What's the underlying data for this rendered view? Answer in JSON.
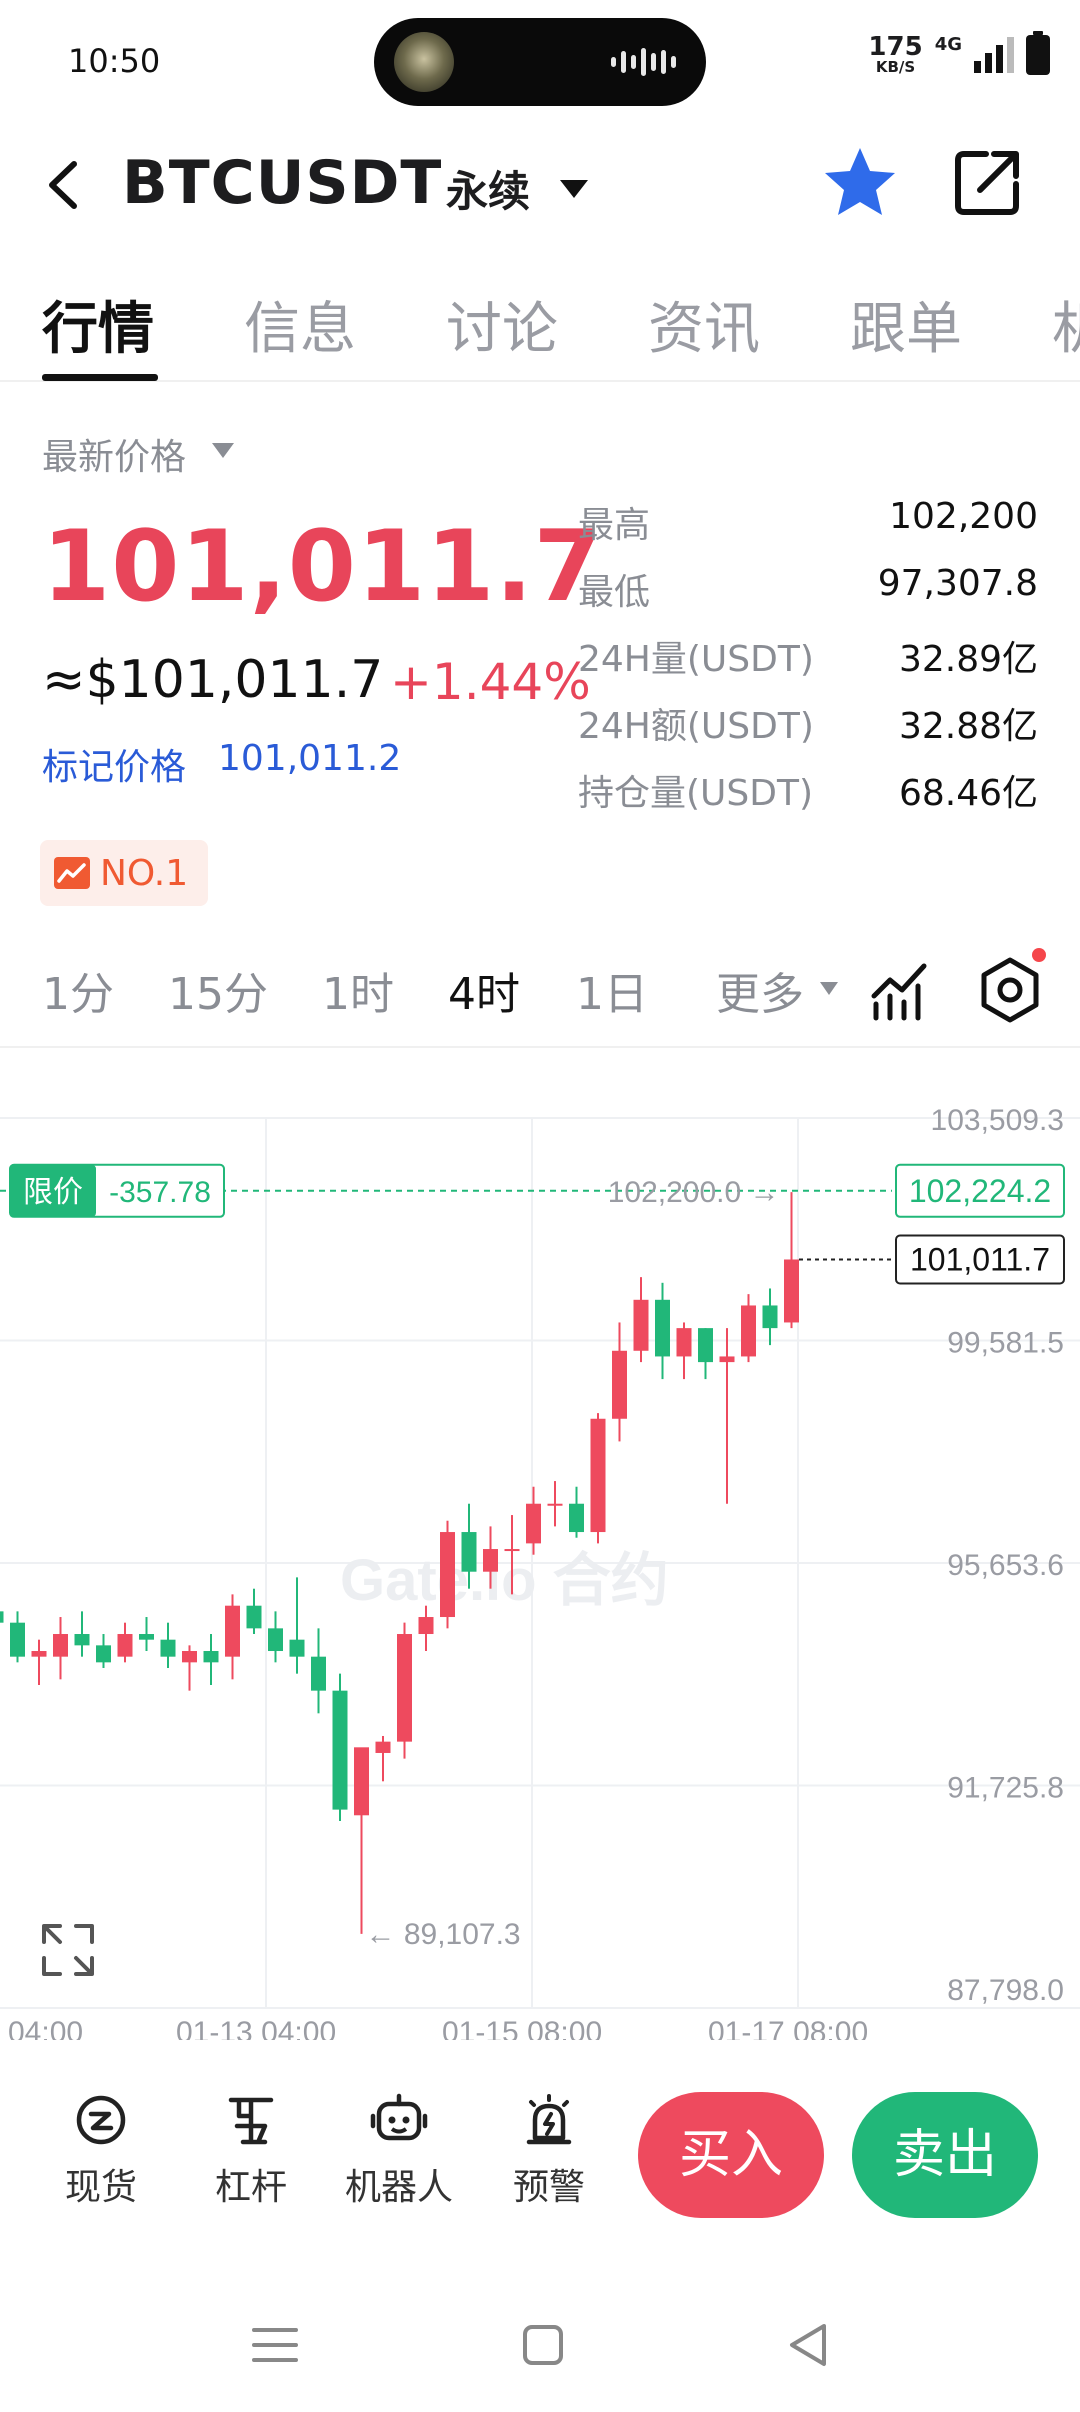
{
  "status_bar": {
    "time": "10:50",
    "speed_value": "175",
    "speed_unit": "KB/S",
    "network": "4G"
  },
  "header": {
    "pair": "BTCUSDT",
    "contract_type": "永续"
  },
  "tabs": [
    {
      "label": "行情",
      "active": true
    },
    {
      "label": "信息",
      "active": false
    },
    {
      "label": "讨论",
      "active": false
    },
    {
      "label": "资讯",
      "active": false
    },
    {
      "label": "跟单",
      "active": false
    },
    {
      "label": "机",
      "active": false
    }
  ],
  "price": {
    "selector_label": "最新价格",
    "last_price": "101,011.7",
    "usd_price": "≈$101,011.7",
    "change_pct": "+1.44%",
    "mark_label": "标记价格",
    "mark_value": "101,011.2",
    "rank_badge": "NO.1"
  },
  "stats": [
    {
      "label": "最高",
      "value": "102,200"
    },
    {
      "label": "最低",
      "value": "97,307.8"
    },
    {
      "label": "24H量(USDT)",
      "value": "32.89亿"
    },
    {
      "label": "24H额(USDT)",
      "value": "32.88亿"
    },
    {
      "label": "持仓量(USDT)",
      "value": "68.46亿"
    }
  ],
  "intervals": {
    "items": [
      {
        "label": "1分",
        "active": false
      },
      {
        "label": "15分",
        "active": false
      },
      {
        "label": "1时",
        "active": false
      },
      {
        "label": "4时",
        "active": true
      },
      {
        "label": "1日",
        "active": false
      }
    ],
    "more_label": "更多"
  },
  "colors": {
    "up": "#ee4a5e",
    "down": "#21b779",
    "mark": "#2a5bd7",
    "badge": "#f05a32"
  },
  "chart_data": {
    "type": "candlestick",
    "interval": "4时",
    "y_ticks": [
      "103,509.3",
      "99,581.5",
      "95,653.6",
      "91,725.8",
      "87,798.0"
    ],
    "ylim": [
      87798.0,
      103509.3
    ],
    "x_ticks": [
      "04:00",
      "01-13 04:00",
      "01-15 08:00",
      "01-17 08:00"
    ],
    "limit_order": {
      "label": "限价",
      "diff": "-357.78",
      "price": 102224.2,
      "price_label": "102,224.2"
    },
    "current_price": {
      "value": 101011.7,
      "label": "101,011.7"
    },
    "high_marker": {
      "value": 102200.0,
      "label": "102,200.0 →"
    },
    "low_marker": {
      "value": 89107.3,
      "label": "← 89,107.3"
    },
    "watermark": "Gate.io 合约",
    "candles": [
      {
        "o": 94800,
        "h": 95100,
        "l": 94300,
        "c": 94600
      },
      {
        "o": 94600,
        "h": 94800,
        "l": 93900,
        "c": 94000
      },
      {
        "o": 94000,
        "h": 94300,
        "l": 93500,
        "c": 94100
      },
      {
        "o": 94000,
        "h": 94700,
        "l": 93600,
        "c": 94400
      },
      {
        "o": 94400,
        "h": 94800,
        "l": 94000,
        "c": 94200
      },
      {
        "o": 94200,
        "h": 94400,
        "l": 93800,
        "c": 93900
      },
      {
        "o": 94000,
        "h": 94600,
        "l": 93900,
        "c": 94400
      },
      {
        "o": 94400,
        "h": 94700,
        "l": 94100,
        "c": 94300
      },
      {
        "o": 94300,
        "h": 94600,
        "l": 93800,
        "c": 94000
      },
      {
        "o": 93900,
        "h": 94200,
        "l": 93400,
        "c": 94100
      },
      {
        "o": 94100,
        "h": 94400,
        "l": 93500,
        "c": 93900
      },
      {
        "o": 94000,
        "h": 95100,
        "l": 93600,
        "c": 94900
      },
      {
        "o": 94900,
        "h": 95200,
        "l": 94400,
        "c": 94500
      },
      {
        "o": 94500,
        "h": 94800,
        "l": 93900,
        "c": 94100
      },
      {
        "o": 94300,
        "h": 95400,
        "l": 93700,
        "c": 94000
      },
      {
        "o": 94000,
        "h": 94500,
        "l": 93000,
        "c": 93400
      },
      {
        "o": 93400,
        "h": 93700,
        "l": 91100,
        "c": 91300
      },
      {
        "o": 91200,
        "h": 92300,
        "l": 89107.3,
        "c": 92400
      },
      {
        "o": 92300,
        "h": 92600,
        "l": 91800,
        "c": 92500
      },
      {
        "o": 92500,
        "h": 94600,
        "l": 92200,
        "c": 94400
      },
      {
        "o": 94400,
        "h": 94900,
        "l": 94100,
        "c": 94700
      },
      {
        "o": 94700,
        "h": 96400,
        "l": 94500,
        "c": 96200
      },
      {
        "o": 96200,
        "h": 96700,
        "l": 95200,
        "c": 95500
      },
      {
        "o": 95500,
        "h": 96300,
        "l": 95200,
        "c": 95900
      },
      {
        "o": 95900,
        "h": 96500,
        "l": 95100,
        "c": 95900
      },
      {
        "o": 96000,
        "h": 97000,
        "l": 95800,
        "c": 96700
      },
      {
        "o": 96700,
        "h": 97100,
        "l": 96300,
        "c": 96700
      },
      {
        "o": 96700,
        "h": 97000,
        "l": 96100,
        "c": 96200
      },
      {
        "o": 96200,
        "h": 98300,
        "l": 96000,
        "c": 98200
      },
      {
        "o": 98200,
        "h": 99900,
        "l": 97800,
        "c": 99400
      },
      {
        "o": 99400,
        "h": 100700,
        "l": 99200,
        "c": 100300
      },
      {
        "o": 100300,
        "h": 100600,
        "l": 98900,
        "c": 99300
      },
      {
        "o": 99300,
        "h": 99900,
        "l": 98900,
        "c": 99800
      },
      {
        "o": 99800,
        "h": 99800,
        "l": 98900,
        "c": 99200
      },
      {
        "o": 99200,
        "h": 99800,
        "l": 96700,
        "c": 99300
      },
      {
        "o": 99300,
        "h": 100400,
        "l": 99200,
        "c": 100200
      },
      {
        "o": 100200,
        "h": 100500,
        "l": 99500,
        "c": 99800
      },
      {
        "o": 99900,
        "h": 102200,
        "l": 99800,
        "c": 101011.7
      }
    ]
  },
  "actions": {
    "spot": "现货",
    "leverage": "杠杆",
    "bot": "机器人",
    "alert": "预警",
    "buy": "买入",
    "sell": "卖出"
  }
}
